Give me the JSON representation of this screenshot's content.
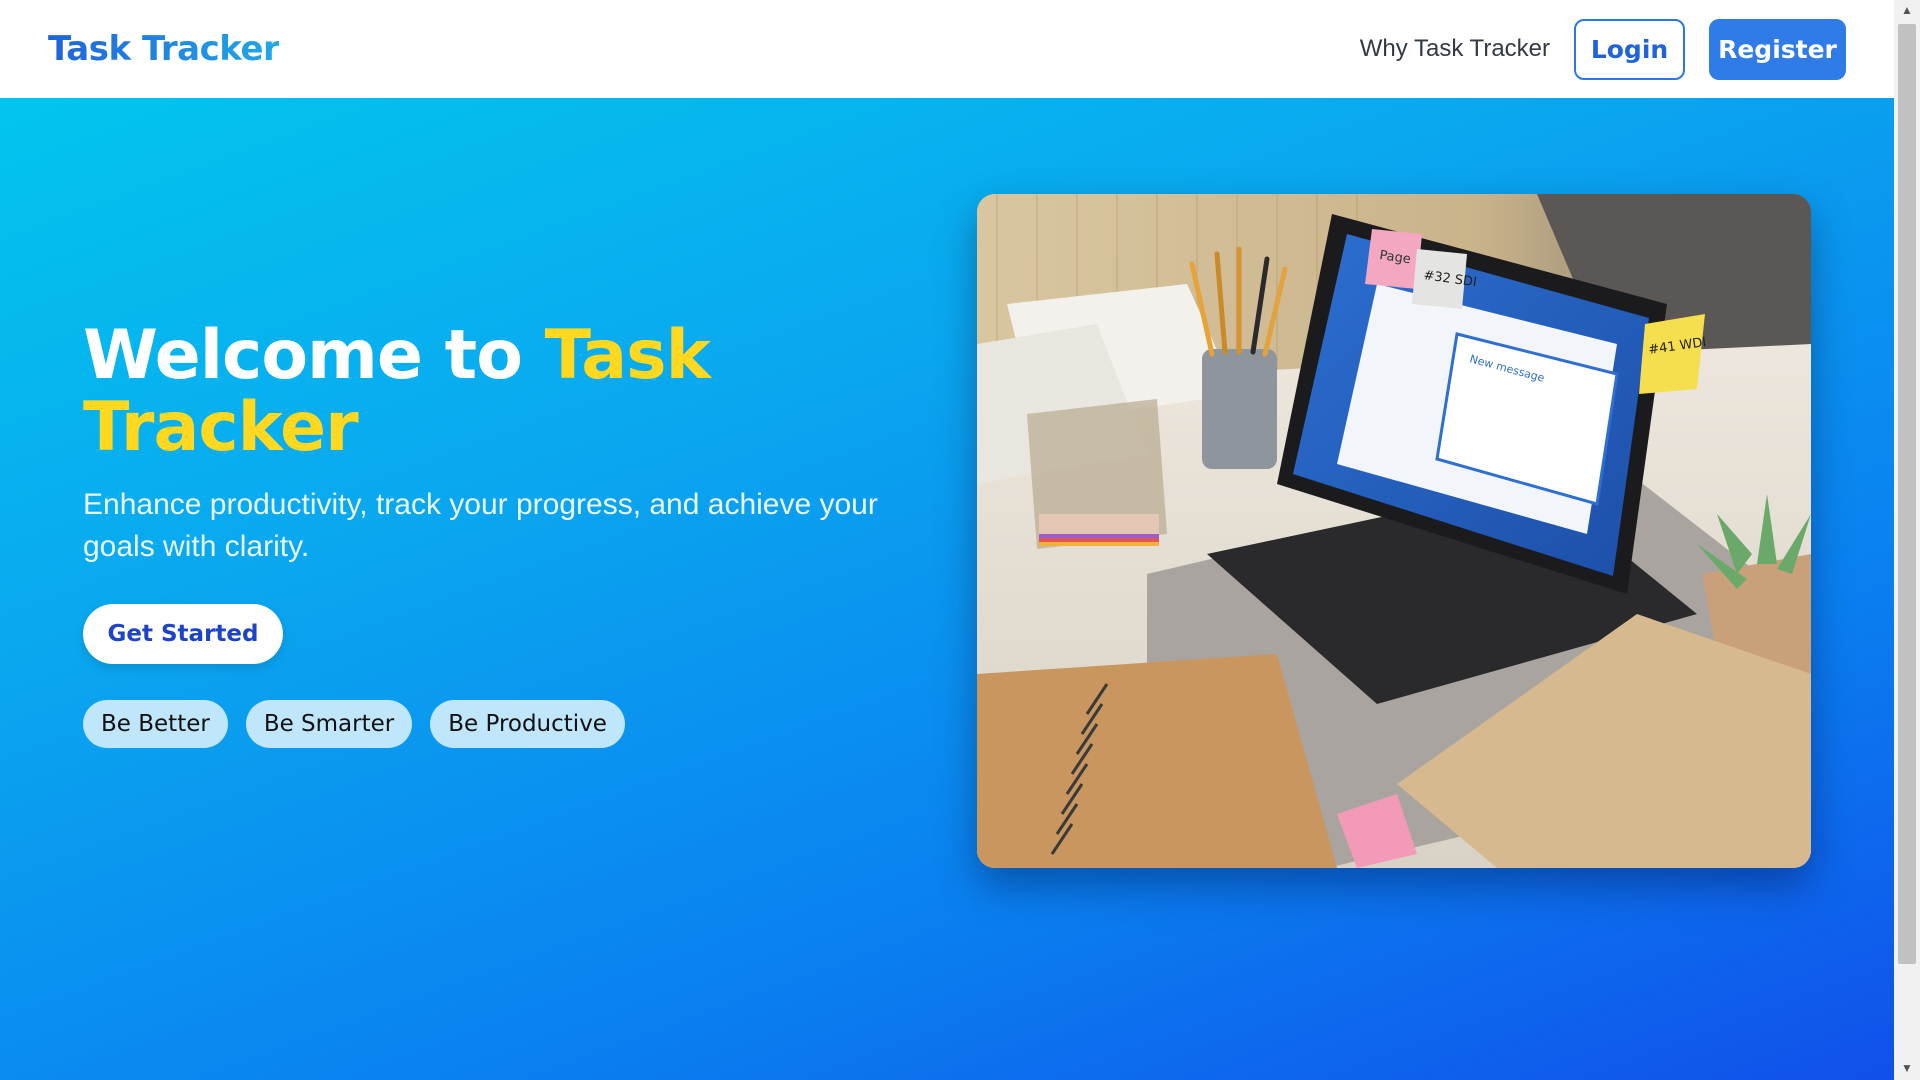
{
  "nav": {
    "brand": "Task Tracker",
    "why_link": "Why Task Tracker",
    "login_label": "Login",
    "register_label": "Register"
  },
  "hero": {
    "headline_prefix": "Welcome to ",
    "headline_accent": "Task Tracker",
    "subtitle": "Enhance productivity, track your progress, and achieve your goals with clarity.",
    "cta_label": "Get Started",
    "tags": [
      "Be Better",
      "Be Smarter",
      "Be Productive"
    ],
    "image_alt": "Desk with laptop, notebooks, pencils and sticky notes",
    "sticky_notes": [
      "Page 137",
      "#32 SDI",
      "#41 WDI"
    ],
    "laptop_screen_title": "New message"
  },
  "colors": {
    "accent": "#ffd81f",
    "primary": "#2f7be8",
    "hero_start": "#02c5ee",
    "hero_end": "#1150ea"
  },
  "icons": {
    "scroll_up": "chevron-up-icon",
    "scroll_down": "chevron-down-icon"
  }
}
